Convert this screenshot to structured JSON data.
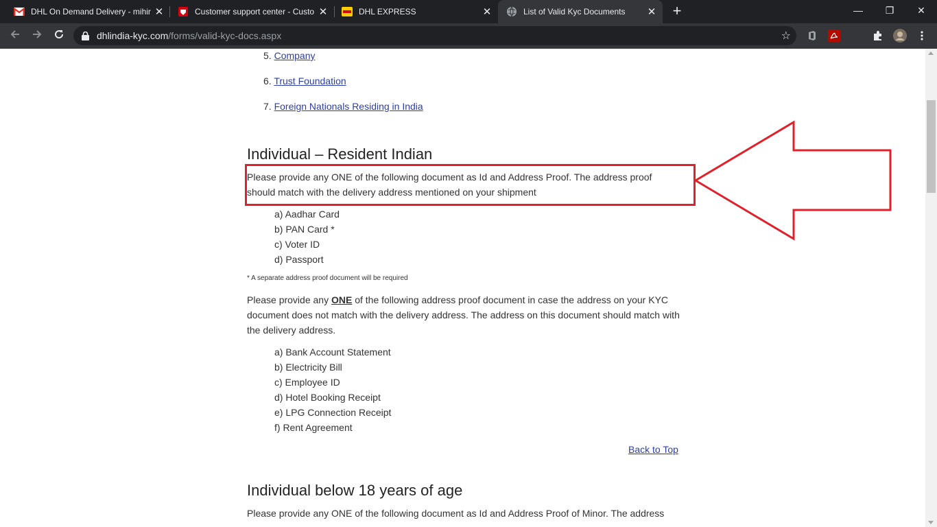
{
  "browser": {
    "tabs": [
      {
        "title": "DHL On Demand Delivery - mihir",
        "icon": "gmail-icon",
        "close": "✕"
      },
      {
        "title": "Customer support center - Custo",
        "icon": "dhl-shield-icon",
        "close": "✕"
      },
      {
        "title": "DHL EXPRESS",
        "icon": "dhl-yellow-icon",
        "close": "✕"
      },
      {
        "title": "List of Valid Kyc Documents",
        "icon": "globe-icon",
        "close": "✕"
      }
    ],
    "new_tab": "+",
    "window_controls": {
      "minimize": "—",
      "restore": "❐",
      "close": "✕"
    },
    "url_host": "dhlindia-kyc.com",
    "url_path": "/forms/valid-kyc-docs.aspx",
    "bookmark_star": "☆"
  },
  "toc": [
    {
      "num": "5.",
      "label": "Company"
    },
    {
      "num": "6.",
      "label": "Trust Foundation"
    },
    {
      "num": "7.",
      "label": "Foreign Nationals Residing in India"
    }
  ],
  "section1": {
    "heading": "Individual – Resident Indian",
    "intro": "Please provide any ONE of the following document as Id and Address Proof. The address proof should match with the delivery address mentioned on your shipment",
    "id_docs": [
      "a) Aadhar Card",
      "b) PAN Card *",
      "c) Voter ID",
      "d) Passport"
    ],
    "footnote": "* A separate address proof document will be required",
    "addr_intro_pre": "Please provide any ",
    "addr_intro_emph": "ONE",
    "addr_intro_post": " of the following address proof document in case the address on your KYC document does not match with the delivery address. The address on this document should match with the delivery address.",
    "addr_docs": [
      "a) Bank Account Statement",
      "b) Electricity Bill",
      "c) Employee ID",
      "d) Hotel Booking Receipt",
      "e) LPG Connection Receipt",
      "f) Rent Agreement"
    ],
    "back_to_top": "Back to Top"
  },
  "section2": {
    "heading": "Individual below 18 years of age",
    "intro": "Please provide any ONE of the following document as Id and Address Proof of Minor. The address"
  },
  "colors": {
    "annotation": "#e0202a",
    "link": "#2b3ea8"
  }
}
